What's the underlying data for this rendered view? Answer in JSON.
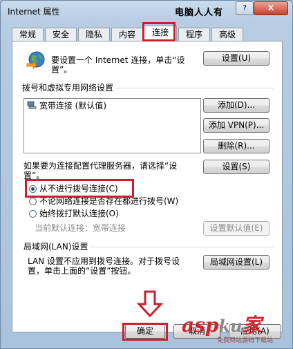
{
  "window": {
    "title": "Internet 属性",
    "watermark_top": "电脑人人有",
    "help": "?",
    "close": "X"
  },
  "tabs": [
    {
      "label": "常规"
    },
    {
      "label": "安全"
    },
    {
      "label": "隐私"
    },
    {
      "label": "内容"
    },
    {
      "label": "连接"
    },
    {
      "label": "程序"
    },
    {
      "label": "高级"
    }
  ],
  "setup": {
    "line1": "要设置一个 Internet 连接，单击“设",
    "line2": "置”。",
    "button": "设置(U)"
  },
  "dialup": {
    "heading": "拨号和虚拟专用网络设置",
    "list_item": "宽带连接 (默认值)",
    "add": "添加(D)...",
    "add_vpn": "添加 VPN(P)...",
    "remove": "删除(R)...",
    "proxy_line1": "如果要为连接配置代理服务器，请选择“设",
    "proxy_line2": "置”。",
    "settings": "设置(S)"
  },
  "options": {
    "never": "从不进行拨号连接(C)",
    "when_no_network": "不论网络连接是否存在都进行拨号(W)",
    "always": "始终拨打默认连接(O)",
    "current_default": "当前默认连接：宽带连接",
    "set_default": "设置默认值(E)",
    "selected": "never"
  },
  "lan": {
    "heading": "局域网(LAN)设置",
    "line1": "LAN 设置不应用到拨号连接。对于拨号设",
    "line2": "置，单击上面的“设置”按钮。",
    "button": "局域网设置(L)"
  },
  "footer": {
    "ok": "确定",
    "cancel": "取消",
    "apply": "应用(A)"
  },
  "watermark": {
    "asp": "asp",
    "ku": "ku",
    "jia": "家",
    "sub": "免费网站源码下载站"
  },
  "colors": {
    "highlight": "#c8202c",
    "radio_dot": "#1a4a86"
  }
}
